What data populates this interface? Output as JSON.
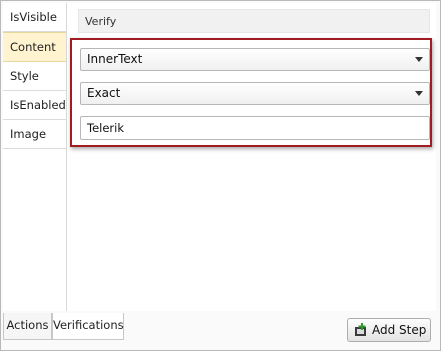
{
  "left_tabs": [
    "IsVisible",
    "Content",
    "Style",
    "IsEnabled",
    "Image"
  ],
  "active_tab": "Content",
  "verify": {
    "header": "Verify",
    "property_value": "InnerText",
    "comparison_value": "Exact",
    "expected_text": "Telerik"
  },
  "bottom_tabs": {
    "actions": "Actions",
    "verifications": "Verifications"
  },
  "add_step_label": "Add Step",
  "colors": {
    "highlight_border": "#9e1c22",
    "active_tab_bg": "#fff4cf"
  },
  "icons": {
    "add_step": "add-step-icon",
    "dropdown": "chevron-down-icon"
  }
}
